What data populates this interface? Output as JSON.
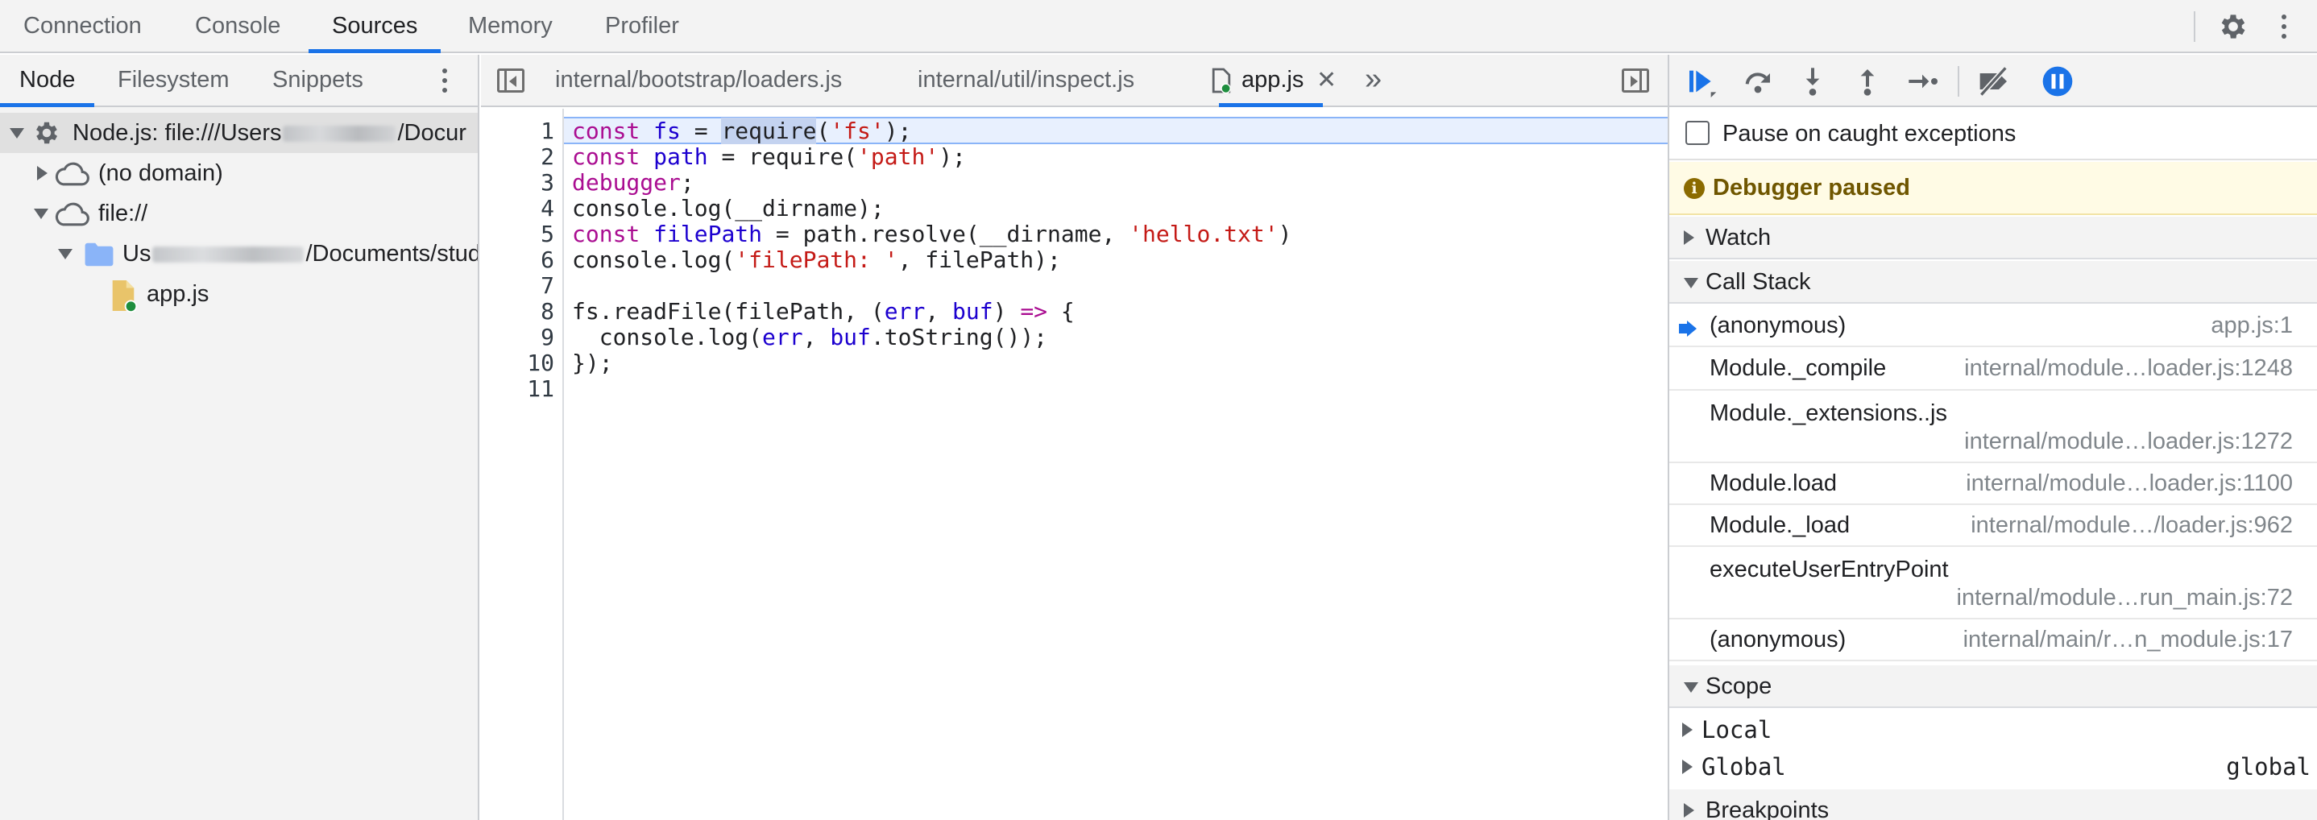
{
  "top_tabs": [
    {
      "label": "Connection"
    },
    {
      "label": "Console"
    },
    {
      "label": "Sources",
      "active": true
    },
    {
      "label": "Memory"
    },
    {
      "label": "Profiler"
    }
  ],
  "top_icons": {
    "settings": "gear-icon",
    "more": "kebab-icon"
  },
  "navigator": {
    "tabs": [
      {
        "label": "Node",
        "active": true
      },
      {
        "label": "Filesystem"
      },
      {
        "label": "Snippets"
      }
    ],
    "tree": [
      {
        "label_start": "Node.js: file:///Users",
        "label_end": "/Docur",
        "icon": "gear-icon",
        "level": 0,
        "expanded": true,
        "selected": true
      },
      {
        "label": "(no domain)",
        "icon": "cloud-icon",
        "level": 1,
        "expanded": false
      },
      {
        "label": "file://",
        "icon": "cloud-icon",
        "level": 1,
        "expanded": true
      },
      {
        "label_start": "Us",
        "label_end": "/Documents/stud",
        "icon": "folder-icon",
        "level": 2,
        "expanded": true
      },
      {
        "label": "app.js",
        "icon": "js-file-icon",
        "level": 3
      }
    ]
  },
  "editor": {
    "tabs": [
      {
        "label": "internal/bootstrap/loaders.js"
      },
      {
        "label": "internal/util/inspect.js"
      },
      {
        "label": "app.js",
        "active": true,
        "closable": true
      }
    ],
    "more_tabs_glyph": "»",
    "line_numbers": [
      "1",
      "2",
      "3",
      "4",
      "5",
      "6",
      "7",
      "8",
      "9",
      "10",
      "11"
    ],
    "code_tokens": {
      "const": "const",
      "fs": "fs",
      "path": "path",
      "filePath": "filePath",
      "eq": " = ",
      "require": "require",
      "fs_str": "'fs'",
      "path_str": "'path'",
      "debugger": "debugger",
      "semi": ";",
      "l1_open": "(",
      "l1_close": ");",
      "l4": "console.log(__dirname);",
      "l5_mid": " = path.resolve(__dirname, ",
      "hello": "'hello.txt'",
      "l5_close": ")",
      "l6_a": "console.log(",
      "fp_str": "'filePath: '",
      "l6_b": ", filePath);",
      "l8_a": "fs.readFile(filePath, (",
      "err": "err",
      "comma": ", ",
      "buf": "buf",
      "l8_b": ") ",
      "arrow": "=>",
      "l8_c": " {",
      "l9_a": "  console.log(",
      "l9_b": ".toString());",
      "l10": "});"
    }
  },
  "debugger": {
    "pause_on_caught_label": "Pause on caught exceptions",
    "pause_on_caught_checked": false,
    "paused_message": "Debugger paused",
    "sections": {
      "watch": "Watch",
      "call_stack": "Call Stack",
      "scope": "Scope",
      "breakpoints": "Breakpoints"
    },
    "call_stack": [
      {
        "name": "(anonymous)",
        "location": "app.js:1",
        "current": true
      },
      {
        "name": "Module._compile",
        "location": "internal/module…loader.js:1248"
      },
      {
        "name": "Module._extensions..js",
        "location": "internal/module…loader.js:1272"
      },
      {
        "name": "Module.load",
        "location": "internal/module…loader.js:1100"
      },
      {
        "name": "Module._load",
        "location": "internal/module…/loader.js:962"
      },
      {
        "name": "executeUserEntryPoint",
        "location": "internal/module…run_main.js:72"
      },
      {
        "name": "(anonymous)",
        "location": "internal/main/r…n_module.js:17"
      }
    ],
    "scope": [
      {
        "name": "Local",
        "value": ""
      },
      {
        "name": "Global",
        "value": "global"
      }
    ],
    "toolbar_icons": [
      "resume-icon",
      "step-over-icon",
      "step-into-icon",
      "step-out-icon",
      "step-icon",
      "deactivate-breakpoints-icon",
      "pause-on-exceptions-icon"
    ]
  },
  "colors": {
    "accent": "#1a73e8",
    "keyword": "#aa0d91",
    "variable": "#1c00cf",
    "string": "#c41a16",
    "paused_banner": "#fffbe5"
  }
}
